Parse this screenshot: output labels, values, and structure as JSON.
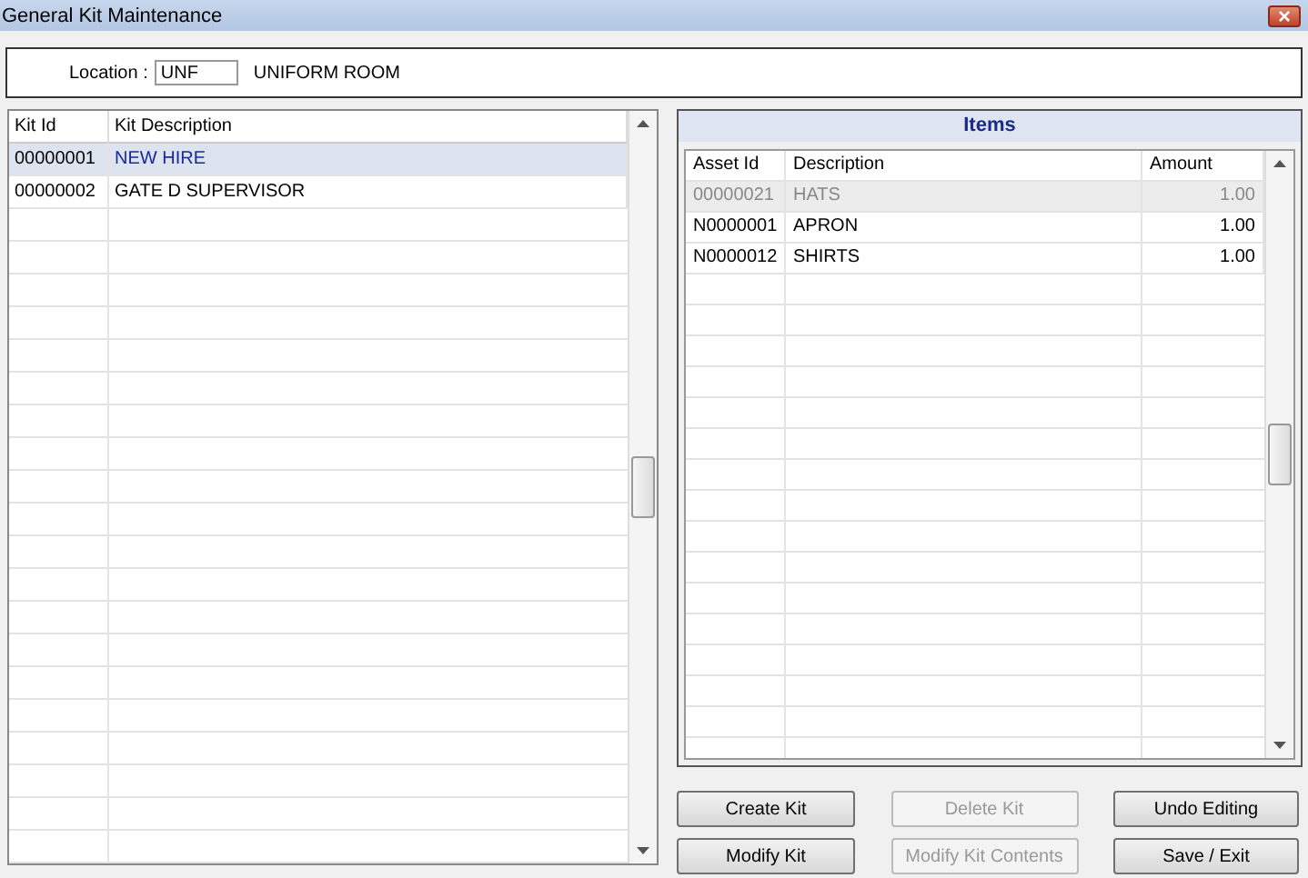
{
  "window": {
    "title": "General Kit Maintenance",
    "close": "×"
  },
  "location": {
    "label": "Location :",
    "value": "UNF",
    "name": "UNIFORM ROOM"
  },
  "kits": {
    "columns": [
      "Kit Id",
      "Kit Description"
    ],
    "rows": [
      {
        "id": "00000001",
        "description": "NEW HIRE",
        "selected": true
      },
      {
        "id": "00000002",
        "description": "GATE D SUPERVISOR",
        "selected": false
      }
    ]
  },
  "items": {
    "title": "Items",
    "columns": [
      "Asset Id",
      "Description",
      "Amount"
    ],
    "rows": [
      {
        "asset_id": "00000021",
        "description": "HATS",
        "amount": "1.00",
        "disabled": true
      },
      {
        "asset_id": "N0000001",
        "description": "APRON",
        "amount": "1.00",
        "disabled": false
      },
      {
        "asset_id": "N0000012",
        "description": "SHIRTS",
        "amount": "1.00",
        "disabled": false
      }
    ]
  },
  "buttons": [
    {
      "label": "Create Kit",
      "disabled": false
    },
    {
      "label": "Delete Kit",
      "disabled": true
    },
    {
      "label": "Undo Editing",
      "disabled": false
    },
    {
      "label": "Modify Kit",
      "disabled": false
    },
    {
      "label": "Modify Kit Contents",
      "disabled": true
    },
    {
      "label": "Save / Exit",
      "disabled": false
    }
  ]
}
